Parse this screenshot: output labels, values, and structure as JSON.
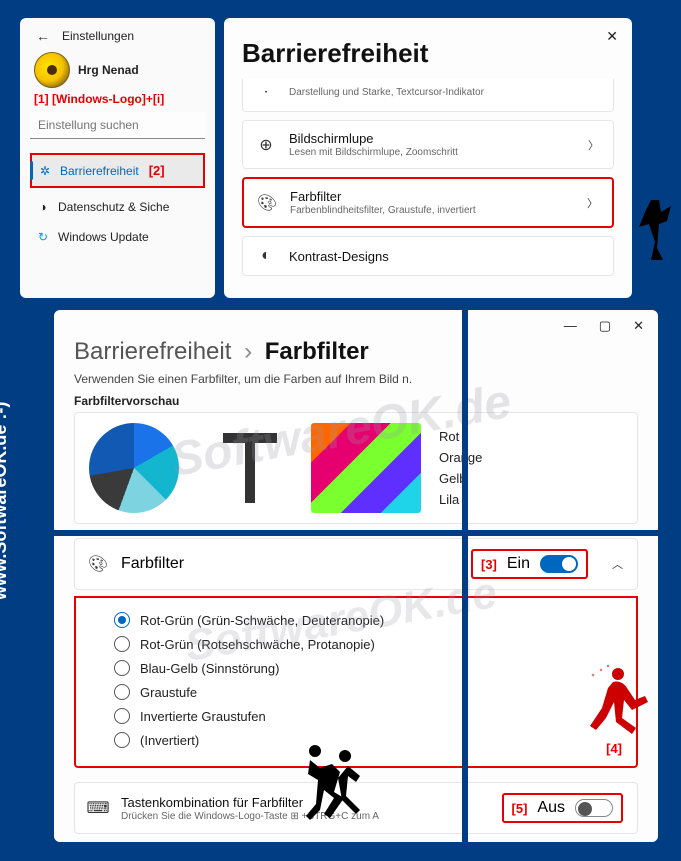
{
  "topLeft": {
    "settingsLabel": "Einstellungen",
    "userName": "Hrg Nenad",
    "anno1": "[1]  [Windows-Logo]+[i]",
    "searchPlaceholder": "Einstellung suchen",
    "navAccessibility": "Barrierefreiheit",
    "navAccessibilityAnno": "[2]",
    "navPrivacy": "Datenschutz & Siche",
    "navUpdate": "Windows Update"
  },
  "topRight": {
    "title": "Barrierefreiheit",
    "card0sub": "Darstellung und Starke, Textcursor-Indikator",
    "card1title": "Bildschirmlupe",
    "card1sub": "Lesen mit Bildschirmlupe, Zoomschritt",
    "card2title": "Farbfilter",
    "card2sub": "Farbenblindheitsfilter, Graustufe, invertiert",
    "card3title": "Kontrast-Designs"
  },
  "bottom": {
    "bcFirst": "Barrierefreiheit",
    "bcSecond": "Farbfilter",
    "subtitle": "Verwenden Sie einen Farbfilter, um die Farben auf Ihrem Bild n.",
    "previewLabel": "Farbfiltervorschau",
    "colors": {
      "red": "Rot",
      "orange": "Orange",
      "yellow": "Gelb",
      "purple": "Lila"
    },
    "filterRowTitle": "Farbfilter",
    "anno3": "[3]",
    "toggleOnLabel": "Ein",
    "radios": {
      "r1": "Rot-Grün (Grün-Schwäche, Deuteranopie)",
      "r2": "Rot-Grün (Rotsehschwäche, Protanopie)",
      "r3": "Blau-Gelb (Sinnstörung)",
      "r4": "Graustufe",
      "r5": "Invertierte Graustufen",
      "r6": "(Invertiert)"
    },
    "anno4": "[4]",
    "shortcutTitle": "Tastenkombination für Farbfilter",
    "shortcutSub": "Drücken Sie die Windows-Logo-Taste ⊞  +STRG+C zum A",
    "anno5": "[5]",
    "toggleOffLabel": "Aus"
  },
  "watermark": "www.SoftwareOK.de  :-)",
  "watermarkCenter": "SoftwareOK.de"
}
